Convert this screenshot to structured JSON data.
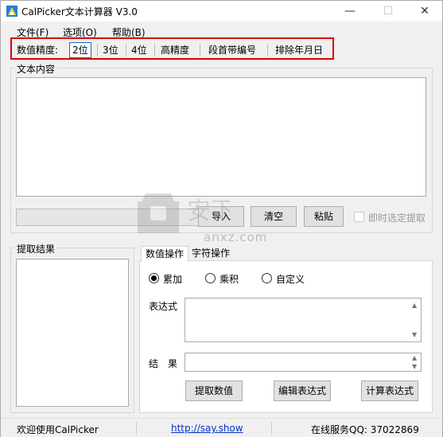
{
  "window": {
    "title": "CalPicker文本计算器 V3.0",
    "min_label": "—",
    "max_label": "☐",
    "close_label": "✕"
  },
  "menu": {
    "file": "文件(F)",
    "options": "选项(O)",
    "help": "帮助(B)"
  },
  "toolbar": {
    "precision_label": "数值精度:",
    "p2": "2位",
    "p3": "3位",
    "p4": "4位",
    "high": "高精度",
    "paragraph_numbered": "段首带编号",
    "exclude_date": "排除年月日"
  },
  "text_content": {
    "title": "文本内容",
    "import_label": "导入",
    "clear_label": "清空",
    "paste_label": "粘贴",
    "instant_extract_label": "即时选定提取"
  },
  "extract_result": {
    "title": "提取结果"
  },
  "tabs": {
    "numeric": "数值操作",
    "string": "字符操作"
  },
  "numeric_ops": {
    "radio_sum": "累加",
    "radio_product": "乘积",
    "radio_custom": "自定义",
    "selected": "累加",
    "expression_label": "表达式",
    "result_label": "结　果",
    "extract_btn": "提取数值",
    "edit_expr_btn": "编辑表达式",
    "calc_expr_btn": "计算表达式"
  },
  "status": {
    "welcome": "欢迎使用CalPicker",
    "link": "http://say.show",
    "qq": "在线服务QQ: 37022869"
  },
  "watermark": {
    "text": "anxz.com"
  },
  "colors": {
    "highlight_border": "#e00000",
    "selected_border": "#0a6dd0",
    "link": "#0033cc"
  }
}
